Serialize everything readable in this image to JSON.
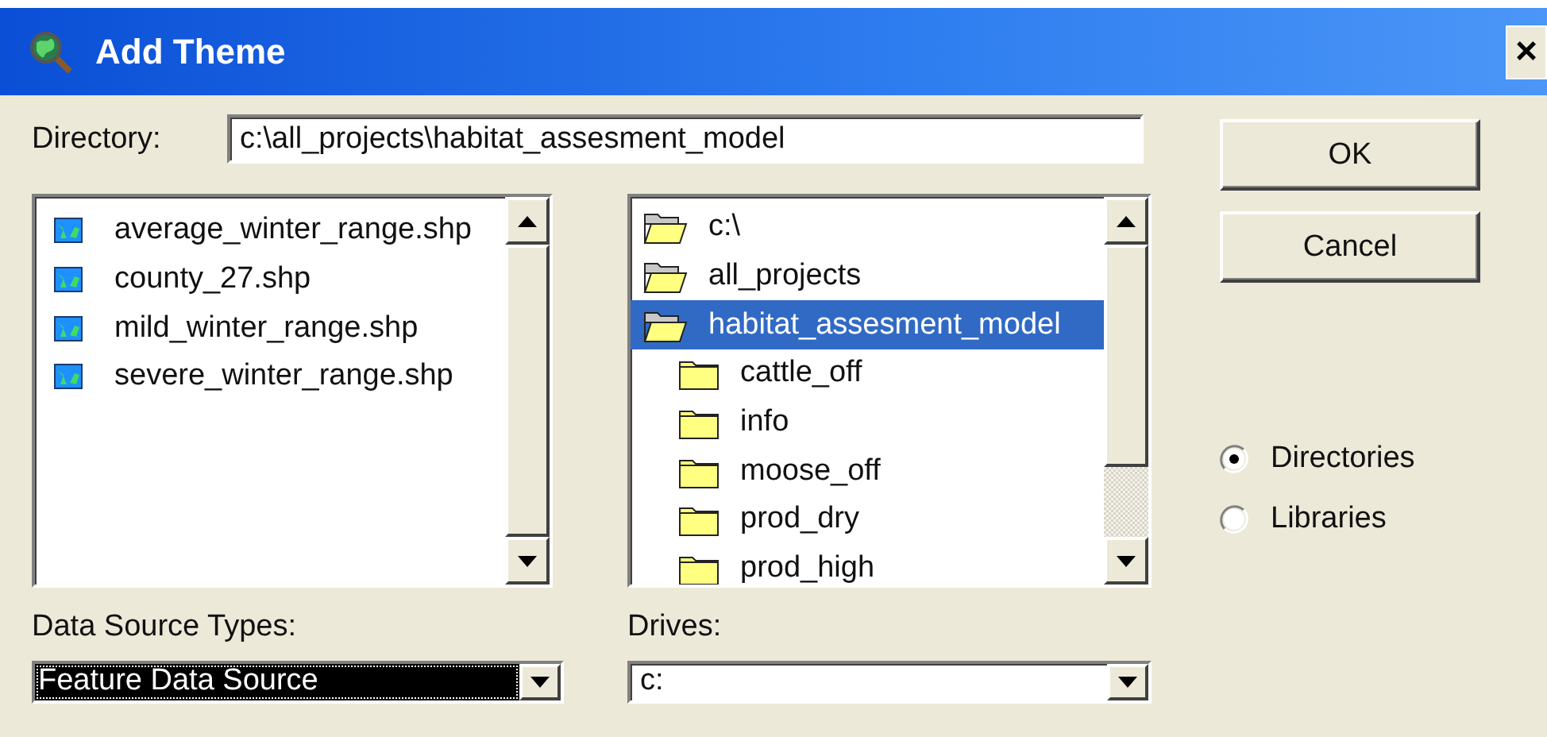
{
  "window": {
    "title": "Add Theme",
    "close": "×"
  },
  "directory": {
    "label": "Directory:",
    "value": "c:\\all_projects\\habitat_assesment_model"
  },
  "files": [
    {
      "name": "average_winter_range.shp"
    },
    {
      "name": "county_27.shp"
    },
    {
      "name": "mild_winter_range.shp"
    },
    {
      "name": "severe_winter_range.shp"
    }
  ],
  "folders": [
    {
      "name": "c:\\",
      "selected": false,
      "children": [
        {
          "name": "all_projects",
          "selected": false,
          "children": [
            {
              "name": "habitat_assesment_model",
              "selected": true,
              "children": [
                {
                  "name": "cattle_off",
                  "selected": false
                },
                {
                  "name": "info",
                  "selected": false
                },
                {
                  "name": "moose_off",
                  "selected": false
                },
                {
                  "name": "prod_dry",
                  "selected": false
                },
                {
                  "name": "prod_high",
                  "selected": false
                }
              ]
            }
          ]
        }
      ]
    }
  ],
  "data_source_types": {
    "label": "Data Source Types:",
    "value": "Feature Data Source",
    "focused": true
  },
  "drives": {
    "label": "Drives:",
    "value": "c:",
    "focused": false
  },
  "buttons": [
    {
      "label": "OK"
    },
    {
      "label": "Cancel"
    }
  ],
  "view_options": [
    {
      "label": "Directories",
      "selected": true
    },
    {
      "label": "Libraries",
      "selected": false
    }
  ]
}
